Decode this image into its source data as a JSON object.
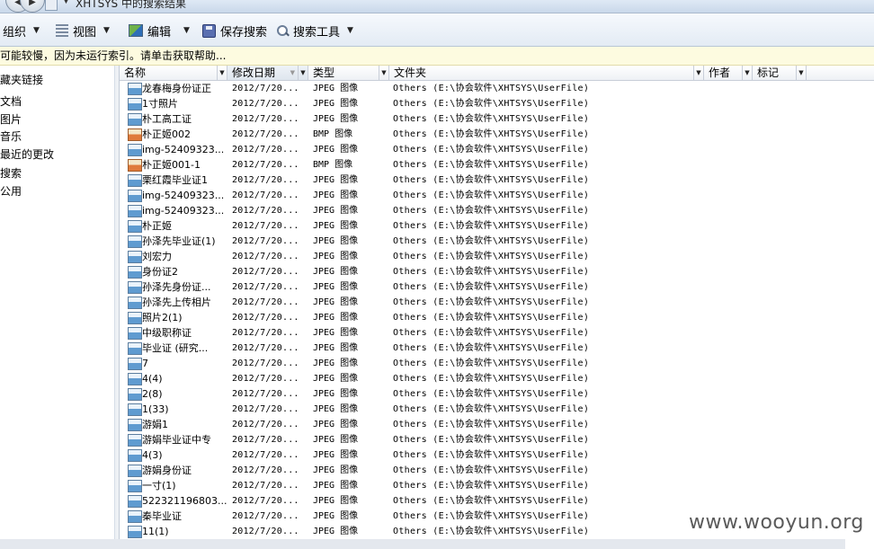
{
  "window": {
    "title": "XHTSYS 中的搜索结果"
  },
  "toolbar": {
    "organize": "组织",
    "view": "视图",
    "edit": "编辑",
    "save_search": "保存搜索",
    "search_tools": "搜索工具"
  },
  "infobar": {
    "text": "可能较慢，因为未运行索引。请单击获取帮助..."
  },
  "sidebar": {
    "items": [
      {
        "label": "藏夹链接"
      },
      {
        "label": "文档"
      },
      {
        "label": "图片"
      },
      {
        "label": "音乐"
      },
      {
        "label": "最近的更改"
      },
      {
        "label": "搜索"
      },
      {
        "label": "公用"
      }
    ]
  },
  "columns": {
    "name": "名称",
    "modified": "修改日期",
    "type": "类型",
    "folder": "文件夹",
    "author": "作者",
    "tags": "标记"
  },
  "files": [
    {
      "name": "龙春梅身份证正",
      "date": "2012/7/20...",
      "type": "JPEG 图像",
      "folder": "Others (E:\\协会软件\\XHTSYS\\UserFile)",
      "icon": "jpeg"
    },
    {
      "name": "1寸照片",
      "date": "2012/7/20...",
      "type": "JPEG 图像",
      "folder": "Others (E:\\协会软件\\XHTSYS\\UserFile)",
      "icon": "jpeg"
    },
    {
      "name": "朴工高工证",
      "date": "2012/7/20...",
      "type": "JPEG 图像",
      "folder": "Others (E:\\协会软件\\XHTSYS\\UserFile)",
      "icon": "jpeg"
    },
    {
      "name": "朴正姬002",
      "date": "2012/7/20...",
      "type": "BMP 图像",
      "folder": "Others (E:\\协会软件\\XHTSYS\\UserFile)",
      "icon": "bmp"
    },
    {
      "name": "img-52409323...",
      "date": "2012/7/20...",
      "type": "JPEG 图像",
      "folder": "Others (E:\\协会软件\\XHTSYS\\UserFile)",
      "icon": "jpeg"
    },
    {
      "name": "朴正姬001-1",
      "date": "2012/7/20...",
      "type": "BMP 图像",
      "folder": "Others (E:\\协会软件\\XHTSYS\\UserFile)",
      "icon": "bmp"
    },
    {
      "name": "栗红霞毕业证1",
      "date": "2012/7/20...",
      "type": "JPEG 图像",
      "folder": "Others (E:\\协会软件\\XHTSYS\\UserFile)",
      "icon": "jpeg"
    },
    {
      "name": "img-52409323...",
      "date": "2012/7/20...",
      "type": "JPEG 图像",
      "folder": "Others (E:\\协会软件\\XHTSYS\\UserFile)",
      "icon": "jpeg"
    },
    {
      "name": "img-52409323...",
      "date": "2012/7/20...",
      "type": "JPEG 图像",
      "folder": "Others (E:\\协会软件\\XHTSYS\\UserFile)",
      "icon": "jpeg"
    },
    {
      "name": "朴正姬",
      "date": "2012/7/20...",
      "type": "JPEG 图像",
      "folder": "Others (E:\\协会软件\\XHTSYS\\UserFile)",
      "icon": "jpeg"
    },
    {
      "name": "孙泽先毕业证(1)",
      "date": "2012/7/20...",
      "type": "JPEG 图像",
      "folder": "Others (E:\\协会软件\\XHTSYS\\UserFile)",
      "icon": "jpeg"
    },
    {
      "name": "刘宏力",
      "date": "2012/7/20...",
      "type": "JPEG 图像",
      "folder": "Others (E:\\协会软件\\XHTSYS\\UserFile)",
      "icon": "jpeg"
    },
    {
      "name": "身份证2",
      "date": "2012/7/20...",
      "type": "JPEG 图像",
      "folder": "Others (E:\\协会软件\\XHTSYS\\UserFile)",
      "icon": "jpeg"
    },
    {
      "name": "孙泽先身份证...",
      "date": "2012/7/20...",
      "type": "JPEG 图像",
      "folder": "Others (E:\\协会软件\\XHTSYS\\UserFile)",
      "icon": "jpeg"
    },
    {
      "name": "孙泽先上传相片",
      "date": "2012/7/20...",
      "type": "JPEG 图像",
      "folder": "Others (E:\\协会软件\\XHTSYS\\UserFile)",
      "icon": "jpeg"
    },
    {
      "name": "照片2(1)",
      "date": "2012/7/20...",
      "type": "JPEG 图像",
      "folder": "Others (E:\\协会软件\\XHTSYS\\UserFile)",
      "icon": "jpeg"
    },
    {
      "name": "中级职称证",
      "date": "2012/7/20...",
      "type": "JPEG 图像",
      "folder": "Others (E:\\协会软件\\XHTSYS\\UserFile)",
      "icon": "jpeg"
    },
    {
      "name": "毕业证 (研究...",
      "date": "2012/7/20...",
      "type": "JPEG 图像",
      "folder": "Others (E:\\协会软件\\XHTSYS\\UserFile)",
      "icon": "jpeg"
    },
    {
      "name": "7",
      "date": "2012/7/20...",
      "type": "JPEG 图像",
      "folder": "Others (E:\\协会软件\\XHTSYS\\UserFile)",
      "icon": "jpeg"
    },
    {
      "name": "4(4)",
      "date": "2012/7/20...",
      "type": "JPEG 图像",
      "folder": "Others (E:\\协会软件\\XHTSYS\\UserFile)",
      "icon": "jpeg"
    },
    {
      "name": "2(8)",
      "date": "2012/7/20...",
      "type": "JPEG 图像",
      "folder": "Others (E:\\协会软件\\XHTSYS\\UserFile)",
      "icon": "jpeg"
    },
    {
      "name": "1(33)",
      "date": "2012/7/20...",
      "type": "JPEG 图像",
      "folder": "Others (E:\\协会软件\\XHTSYS\\UserFile)",
      "icon": "jpeg"
    },
    {
      "name": "游娟1",
      "date": "2012/7/20...",
      "type": "JPEG 图像",
      "folder": "Others (E:\\协会软件\\XHTSYS\\UserFile)",
      "icon": "jpeg"
    },
    {
      "name": "游娟毕业证中专",
      "date": "2012/7/20...",
      "type": "JPEG 图像",
      "folder": "Others (E:\\协会软件\\XHTSYS\\UserFile)",
      "icon": "jpeg"
    },
    {
      "name": "4(3)",
      "date": "2012/7/20...",
      "type": "JPEG 图像",
      "folder": "Others (E:\\协会软件\\XHTSYS\\UserFile)",
      "icon": "jpeg"
    },
    {
      "name": "游娟身份证",
      "date": "2012/7/20...",
      "type": "JPEG 图像",
      "folder": "Others (E:\\协会软件\\XHTSYS\\UserFile)",
      "icon": "jpeg"
    },
    {
      "name": "一寸(1)",
      "date": "2012/7/20...",
      "type": "JPEG 图像",
      "folder": "Others (E:\\协会软件\\XHTSYS\\UserFile)",
      "icon": "jpeg"
    },
    {
      "name": "522321196803...",
      "date": "2012/7/20...",
      "type": "JPEG 图像",
      "folder": "Others (E:\\协会软件\\XHTSYS\\UserFile)",
      "icon": "jpeg"
    },
    {
      "name": "秦毕业证",
      "date": "2012/7/20...",
      "type": "JPEG 图像",
      "folder": "Others (E:\\协会软件\\XHTSYS\\UserFile)",
      "icon": "jpeg"
    },
    {
      "name": "11(1)",
      "date": "2012/7/20...",
      "type": "JPEG 图像",
      "folder": "Others (E:\\协会软件\\XHTSYS\\UserFile)",
      "icon": "jpeg"
    }
  ],
  "watermark": "www.wooyun.org"
}
